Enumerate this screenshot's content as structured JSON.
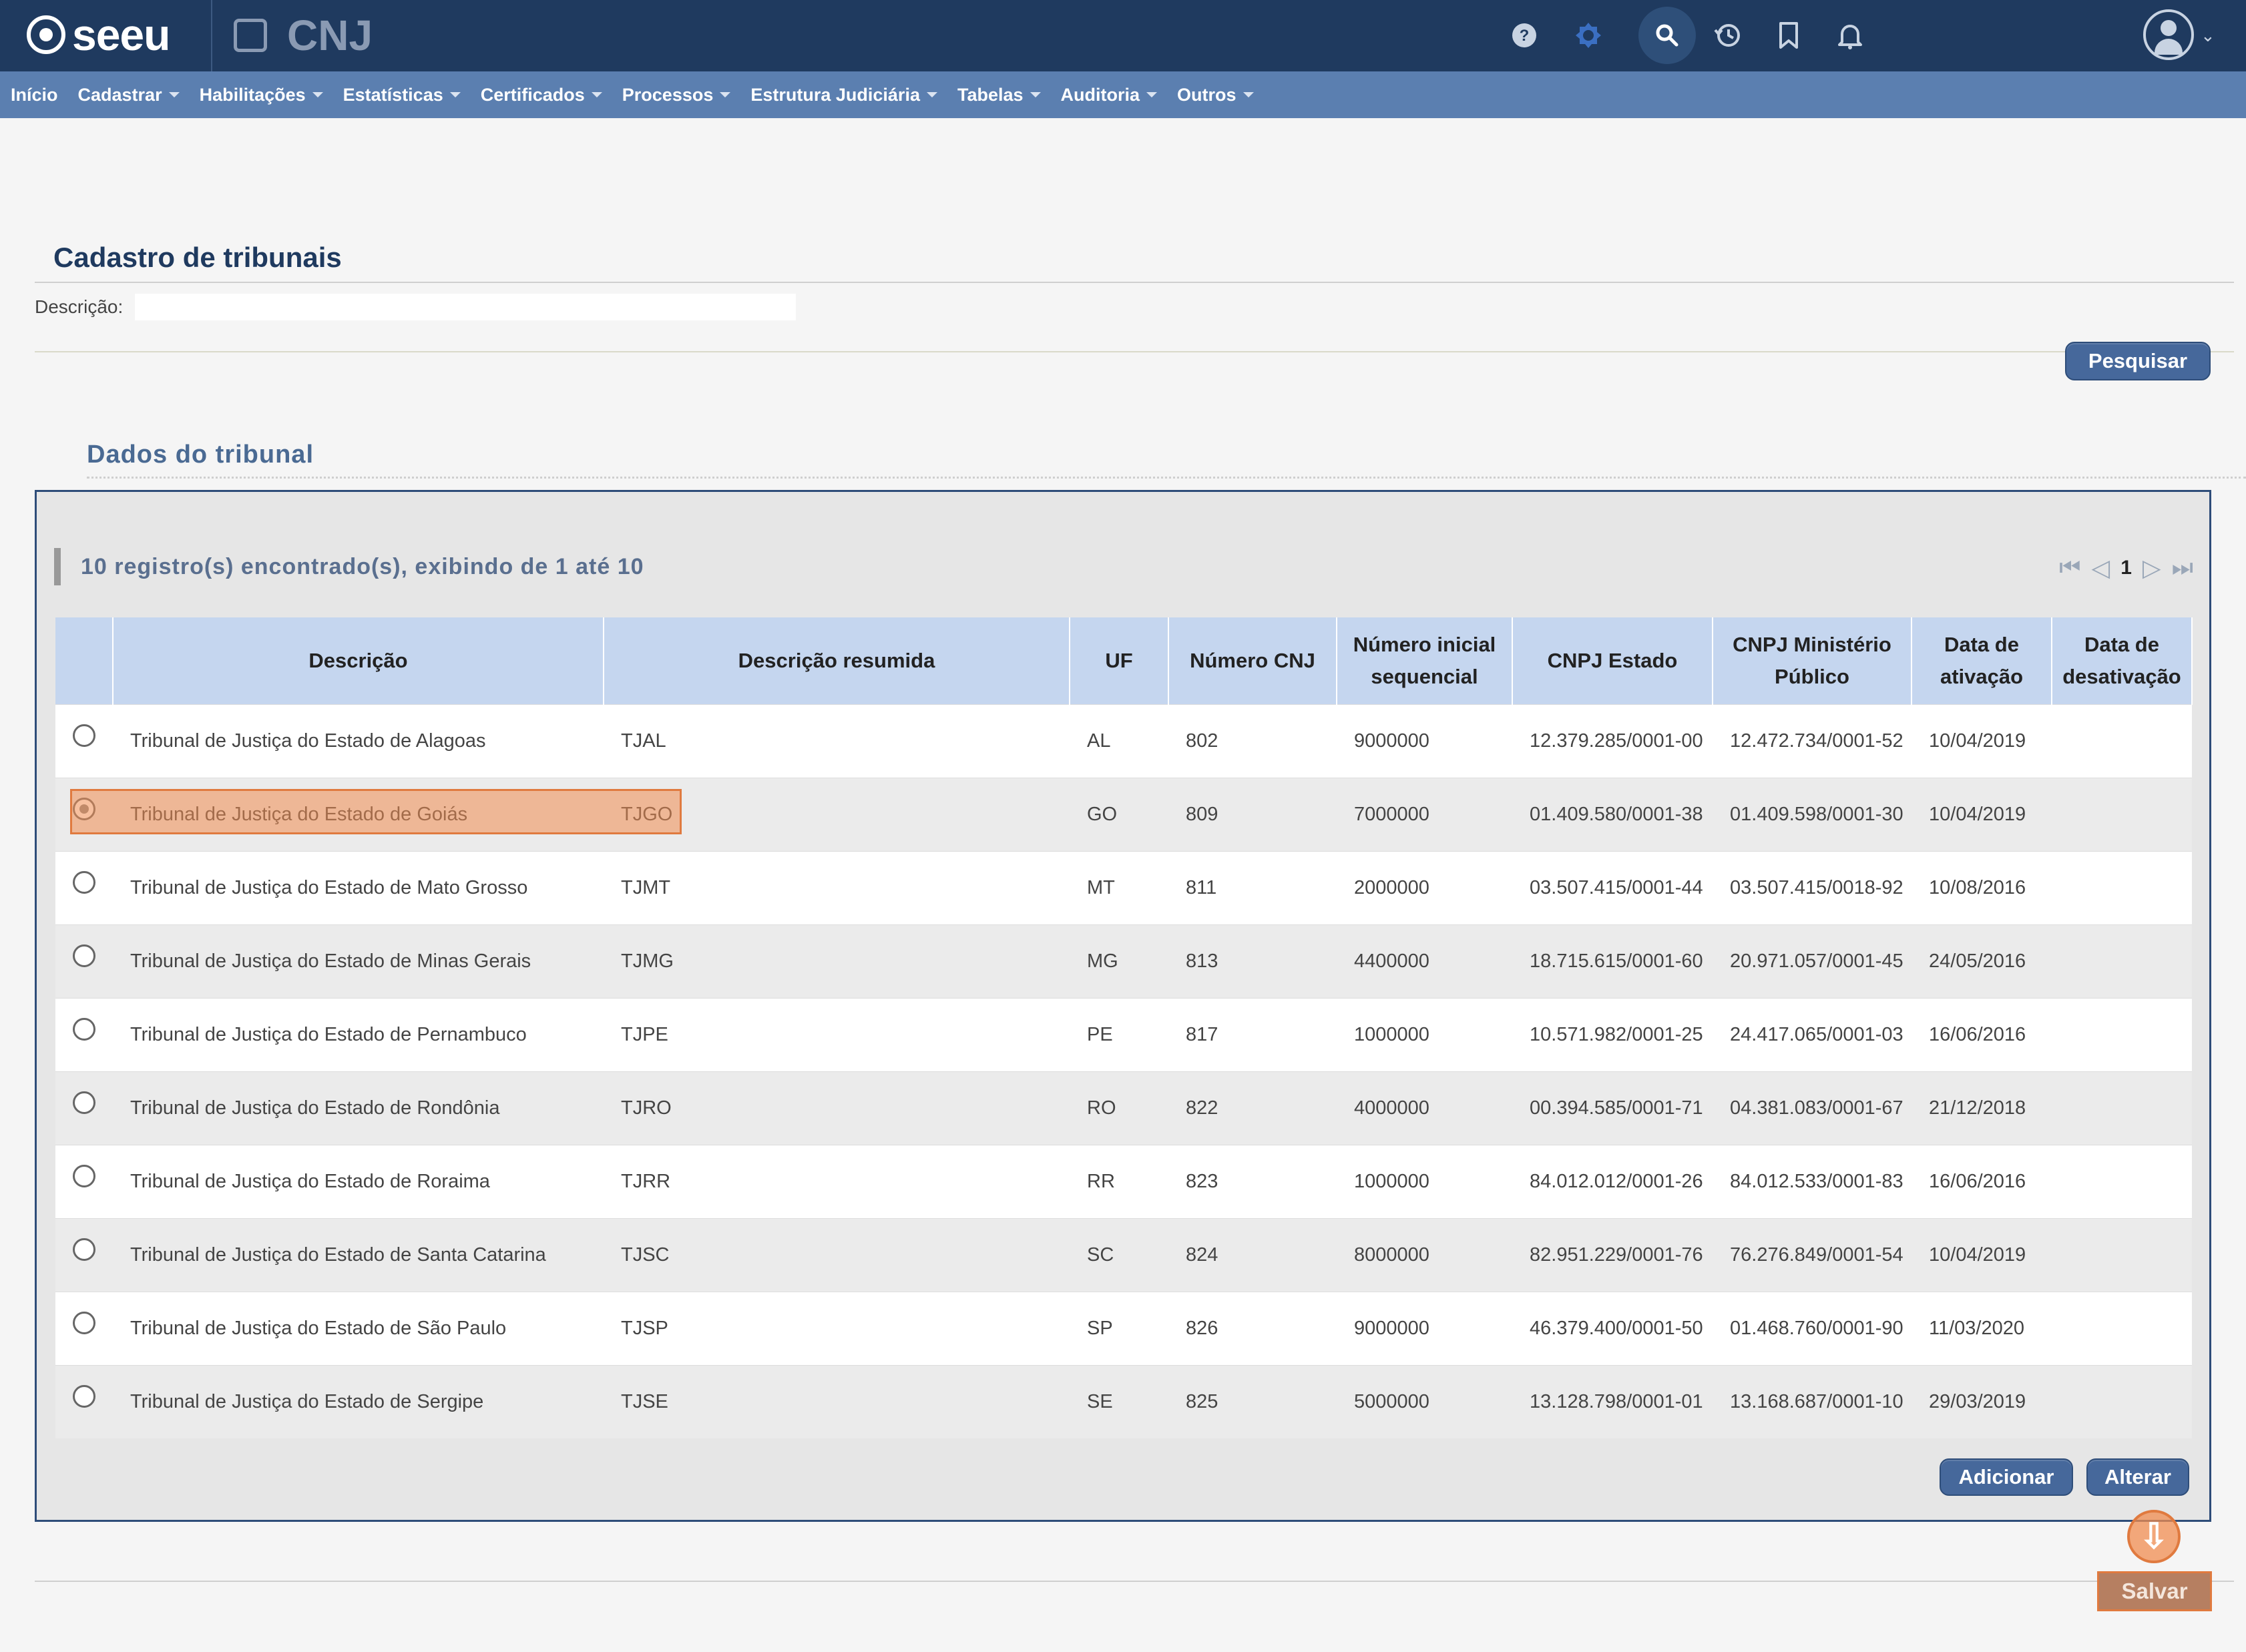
{
  "app": {
    "logo_text": "seeu",
    "partner_logo_text": "CNJ"
  },
  "topbar_icons": [
    "help-icon",
    "theme-icon",
    "search-icon",
    "history-icon",
    "bookmark-icon",
    "bell-icon",
    "user-avatar-icon"
  ],
  "menu": {
    "items": [
      {
        "label": "Início",
        "dropdown": false
      },
      {
        "label": "Cadastrar",
        "dropdown": true
      },
      {
        "label": "Habilitações",
        "dropdown": true
      },
      {
        "label": "Estatísticas",
        "dropdown": true
      },
      {
        "label": "Certificados",
        "dropdown": true
      },
      {
        "label": "Processos",
        "dropdown": true
      },
      {
        "label": "Estrutura Judiciária",
        "dropdown": true
      },
      {
        "label": "Tabelas",
        "dropdown": true
      },
      {
        "label": "Auditoria",
        "dropdown": true
      },
      {
        "label": "Outros",
        "dropdown": true
      }
    ]
  },
  "page": {
    "title": "Cadastro de tribunais"
  },
  "search": {
    "description_label": "Descrição:",
    "description_value": "",
    "search_button": "Pesquisar"
  },
  "section": {
    "title": "Dados do tribunal"
  },
  "results": {
    "summary": "10 registro(s) encontrado(s), exibindo de 1 até 10",
    "current_page": "1"
  },
  "table": {
    "headers": {
      "descricao": "Descrição",
      "descricao_resumida": "Descrição resumida",
      "uf": "UF",
      "numero_cnj": "Número CNJ",
      "numero_inicial": "Número inicial sequencial",
      "cnpj_estado": "CNPJ Estado",
      "cnpj_mp": "CNPJ Ministério Público",
      "data_ativacao": "Data de ativação",
      "data_desativacao": "Data de desativação"
    },
    "rows": [
      {
        "selected": false,
        "descricao": "Tribunal de Justiça do Estado de Alagoas",
        "resumida": "TJAL",
        "uf": "AL",
        "cnj": "802",
        "inicial": "9000000",
        "cnpj_estado": "12.379.285/0001-00",
        "cnpj_mp": "12.472.734/0001-52",
        "ativacao": "10/04/2019",
        "desativacao": ""
      },
      {
        "selected": true,
        "descricao": "Tribunal de Justiça do Estado de Goiás",
        "resumida": "TJGO",
        "uf": "GO",
        "cnj": "809",
        "inicial": "7000000",
        "cnpj_estado": "01.409.580/0001-38",
        "cnpj_mp": "01.409.598/0001-30",
        "ativacao": "10/04/2019",
        "desativacao": ""
      },
      {
        "selected": false,
        "descricao": "Tribunal de Justiça do Estado de Mato Grosso",
        "resumida": "TJMT",
        "uf": "MT",
        "cnj": "811",
        "inicial": "2000000",
        "cnpj_estado": "03.507.415/0001-44",
        "cnpj_mp": "03.507.415/0018-92",
        "ativacao": "10/08/2016",
        "desativacao": ""
      },
      {
        "selected": false,
        "descricao": "Tribunal de Justiça do Estado de Minas Gerais",
        "resumida": "TJMG",
        "uf": "MG",
        "cnj": "813",
        "inicial": "4400000",
        "cnpj_estado": "18.715.615/0001-60",
        "cnpj_mp": "20.971.057/0001-45",
        "ativacao": "24/05/2016",
        "desativacao": ""
      },
      {
        "selected": false,
        "descricao": "Tribunal de Justiça do Estado de Pernambuco",
        "resumida": "TJPE",
        "uf": "PE",
        "cnj": "817",
        "inicial": "1000000",
        "cnpj_estado": "10.571.982/0001-25",
        "cnpj_mp": "24.417.065/0001-03",
        "ativacao": "16/06/2016",
        "desativacao": ""
      },
      {
        "selected": false,
        "descricao": "Tribunal de Justiça do Estado de Rondônia",
        "resumida": "TJRO",
        "uf": "RO",
        "cnj": "822",
        "inicial": "4000000",
        "cnpj_estado": "00.394.585/0001-71",
        "cnpj_mp": "04.381.083/0001-67",
        "ativacao": "21/12/2018",
        "desativacao": ""
      },
      {
        "selected": false,
        "descricao": "Tribunal de Justiça do Estado de Roraima",
        "resumida": "TJRR",
        "uf": "RR",
        "cnj": "823",
        "inicial": "1000000",
        "cnpj_estado": "84.012.012/0001-26",
        "cnpj_mp": "84.012.533/0001-83",
        "ativacao": "16/06/2016",
        "desativacao": ""
      },
      {
        "selected": false,
        "descricao": "Tribunal de Justiça do Estado de Santa Catarina",
        "resumida": "TJSC",
        "uf": "SC",
        "cnj": "824",
        "inicial": "8000000",
        "cnpj_estado": "82.951.229/0001-76",
        "cnpj_mp": "76.276.849/0001-54",
        "ativacao": "10/04/2019",
        "desativacao": ""
      },
      {
        "selected": false,
        "descricao": "Tribunal de Justiça do Estado de São Paulo",
        "resumida": "TJSP",
        "uf": "SP",
        "cnj": "826",
        "inicial": "9000000",
        "cnpj_estado": "46.379.400/0001-50",
        "cnpj_mp": "01.468.760/0001-90",
        "ativacao": "11/03/2020",
        "desativacao": ""
      },
      {
        "selected": false,
        "descricao": "Tribunal de Justiça do Estado de Sergipe",
        "resumida": "TJSE",
        "uf": "SE",
        "cnj": "825",
        "inicial": "5000000",
        "cnpj_estado": "13.128.798/0001-01",
        "cnpj_mp": "13.168.687/0001-10",
        "ativacao": "29/03/2019",
        "desativacao": ""
      }
    ]
  },
  "actions": {
    "add": "Adicionar",
    "edit": "Alterar",
    "save": "Salvar"
  },
  "colors": {
    "topbar": "#1f3a5f",
    "menubar": "#5b7fb0",
    "button": "#46689b",
    "header_row": "#c5d6ef",
    "highlight": "#e07a3f"
  }
}
